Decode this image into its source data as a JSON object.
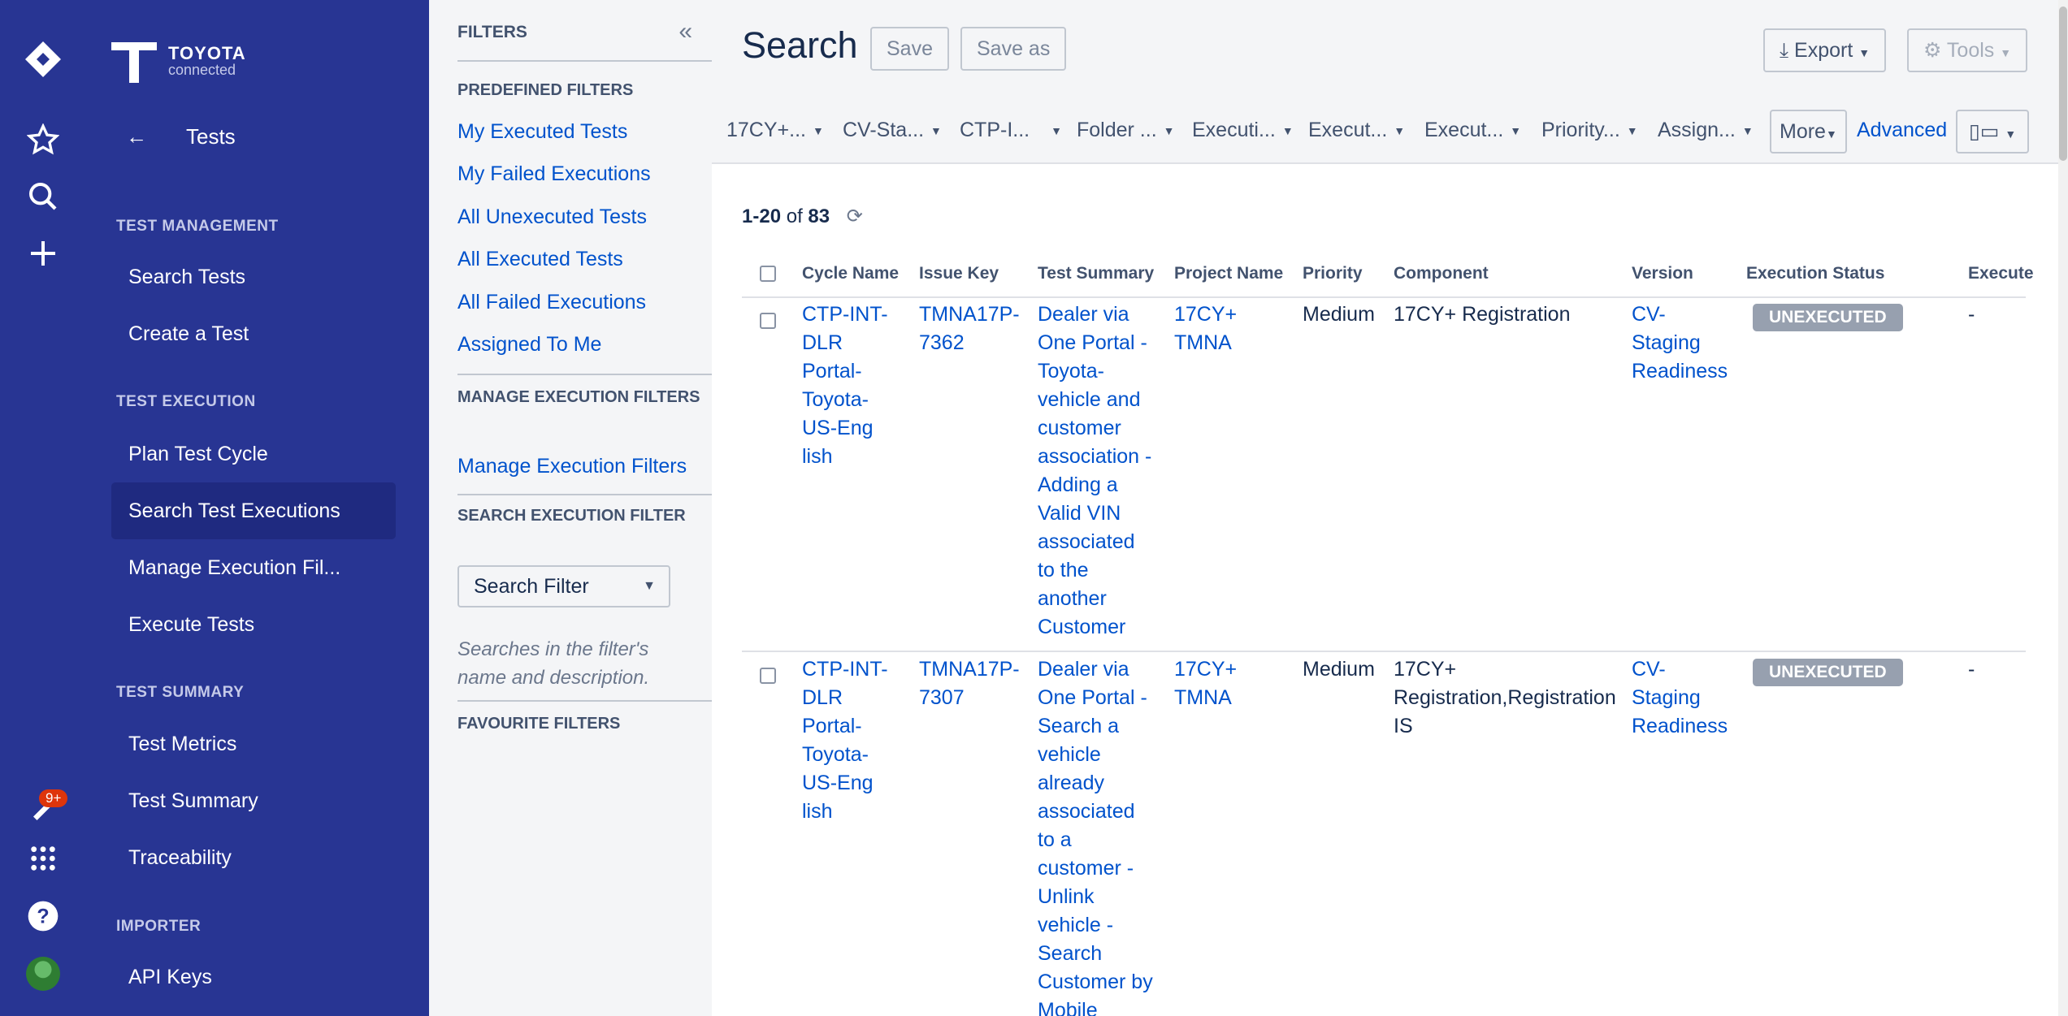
{
  "nav": {
    "logo_line1": "TOYOTA",
    "logo_line2": "connected",
    "back_label": "Tests",
    "sections": [
      {
        "title": "TEST MANAGEMENT",
        "items": [
          "Search Tests",
          "Create a Test"
        ]
      },
      {
        "title": "TEST EXECUTION",
        "items": [
          "Plan Test Cycle",
          "Search Test Executions",
          "Manage Execution Fil...",
          "Execute Tests"
        ]
      },
      {
        "title": "TEST SUMMARY",
        "items": [
          "Test Metrics",
          "Test Summary",
          "Traceability"
        ]
      },
      {
        "title": "IMPORTER",
        "items": [
          "API Keys"
        ]
      }
    ],
    "notification_badge": "9+"
  },
  "filters": {
    "header": "FILTERS",
    "predefined_title": "PREDEFINED FILTERS",
    "predefined": [
      "My Executed Tests",
      "My Failed Executions",
      "All Unexecuted Tests",
      "All Executed Tests",
      "All Failed Executions",
      "Assigned To Me"
    ],
    "manage_title": "MANAGE EXECUTION FILTERS",
    "manage_link": "Manage Execution Filters",
    "search_title": "SEARCH EXECUTION FILTER",
    "search_select": "Search Filter",
    "search_hint": "Searches in the filter's name and description.",
    "favourite_title": "FAVOURITE FILTERS"
  },
  "main": {
    "title": "Search",
    "save": "Save",
    "save_as": "Save as",
    "export": "Export",
    "tools": "Tools",
    "quick_filters": [
      "17CY+...",
      "CV-Sta...",
      "CTP-I...",
      "Folder ...",
      "Executi...",
      "Execut...",
      "Execut...",
      "Priority...",
      "Assign..."
    ],
    "more": "More",
    "advanced": "Advanced",
    "count_range": "1-20",
    "count_of": "of",
    "count_total": "83"
  },
  "table": {
    "headers": [
      "Cycle Name",
      "Issue Key",
      "Test Summary",
      "Project Name",
      "Priority",
      "Component",
      "Version",
      "Execution Status",
      "Execute"
    ],
    "rows": [
      {
        "cycle": [
          "CTP-INT-",
          "DLR",
          "Portal-",
          "Toyota-",
          "US-Eng",
          "lish"
        ],
        "key": [
          "TMNA17P-",
          "7362"
        ],
        "summary": [
          "Dealer via",
          "One Portal -",
          "Toyota-",
          "vehicle and",
          "customer",
          "association -",
          "Adding a",
          "Valid VIN",
          "associated",
          "to the",
          "another",
          "Customer"
        ],
        "project": [
          "17CY+",
          "TMNA"
        ],
        "priority": "Medium",
        "component": [
          "17CY+ Registration"
        ],
        "version": [
          "CV-",
          "Staging",
          "Readiness"
        ],
        "status": "UNEXECUTED",
        "executed": "-"
      },
      {
        "cycle": [
          "CTP-INT-",
          "DLR",
          "Portal-",
          "Toyota-",
          "US-Eng",
          "lish"
        ],
        "key": [
          "TMNA17P-",
          "7307"
        ],
        "summary": [
          "Dealer via",
          "One Portal -",
          "Search a",
          "vehicle",
          "already",
          "associated",
          "to a",
          "customer -",
          "Unlink",
          "vehicle -",
          "Search",
          "Customer by",
          "Mobile"
        ],
        "project": [
          "17CY+",
          "TMNA"
        ],
        "priority": "Medium",
        "component": [
          "17CY+",
          "Registration,Registration",
          "IS"
        ],
        "version": [
          "CV-",
          "Staging",
          "Readiness"
        ],
        "status": "UNEXECUTED",
        "executed": "-"
      }
    ]
  },
  "colors": {
    "sidebar": "#283593",
    "link": "#0052cc",
    "badge": "#97a0af",
    "notif": "#de350b"
  }
}
